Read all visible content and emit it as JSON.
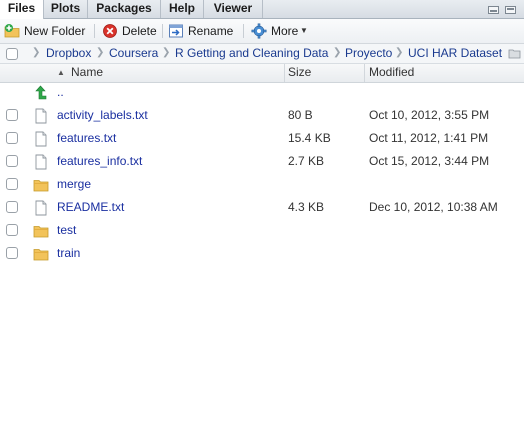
{
  "tabs": [
    {
      "label": "Files",
      "active": true
    },
    {
      "label": "Plots",
      "active": false
    },
    {
      "label": "Packages",
      "active": false
    },
    {
      "label": "Help",
      "active": false
    },
    {
      "label": "Viewer",
      "active": false
    }
  ],
  "toolbar": {
    "new_folder": "New Folder",
    "delete": "Delete",
    "rename": "Rename",
    "more": "More"
  },
  "breadcrumb": [
    "Dropbox",
    "Coursera",
    "R Getting and Cleaning Data",
    "Proyecto",
    "UCI HAR Dataset"
  ],
  "columns": {
    "name": "Name",
    "size": "Size",
    "modified": "Modified"
  },
  "parent_dir": "..",
  "files": [
    {
      "name": "activity_labels.txt",
      "type": "file",
      "size": "80 B",
      "modified": "Oct 10, 2012, 3:55 PM"
    },
    {
      "name": "features.txt",
      "type": "file",
      "size": "15.4 KB",
      "modified": "Oct 11, 2012, 1:41 PM"
    },
    {
      "name": "features_info.txt",
      "type": "file",
      "size": "2.7 KB",
      "modified": "Oct 15, 2012, 3:44 PM"
    },
    {
      "name": "merge",
      "type": "folder",
      "size": "",
      "modified": ""
    },
    {
      "name": "README.txt",
      "type": "file",
      "size": "4.3 KB",
      "modified": "Dec 10, 2012, 10:38 AM"
    },
    {
      "name": "test",
      "type": "folder",
      "size": "",
      "modified": ""
    },
    {
      "name": "train",
      "type": "folder",
      "size": "",
      "modified": ""
    }
  ],
  "colors": {
    "link": "#1a2fa0",
    "folder": "#f2c35a",
    "up_arrow": "#2fa84a"
  }
}
